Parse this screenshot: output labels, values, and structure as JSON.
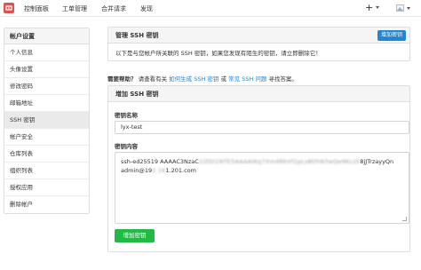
{
  "header": {
    "nav": [
      "控制面板",
      "工单管理",
      "合并请求",
      "发现"
    ],
    "plus": "+"
  },
  "sidebar": {
    "title": "帐户设置",
    "items": [
      "个人信息",
      "头像设置",
      "修改密码",
      "邮箱地址",
      "SSH 密钥",
      "帐户安全",
      "仓库列表",
      "组织列表",
      "授权应用",
      "删除帐户"
    ],
    "active_index": 4
  },
  "manage": {
    "title": "管理 SSH 密钥",
    "add_button": "增加密钥",
    "info": "以下是与您帐户所关联的 SSH 密钥，如果您发现有陌生的密钥，请立即删除它！"
  },
  "help": {
    "prefix": "需要帮助？",
    "text1": " 请查看有关 ",
    "link1": "如何生成 SSH 密钥",
    "text2": " 或 ",
    "link2": "常见 SSH 问题",
    "text3": " 寻找答案。"
  },
  "add_form": {
    "title": "增加 SSH 密钥",
    "name_label": "密钥名称",
    "name_value": "lyx-test",
    "content_label": "密钥内容",
    "content_start": "ssh-ed25519 AAAAC3NzaC",
    "content_blurred": "1lZDI1NTE5AAAAIKq7Xm4RbVf2pLs8DhN3wQe9Kcz5",
    "content_end": "8jJTrzayyQn",
    "content_line2_start": "admin@19",
    "content_line2_blurred": "2.16",
    "content_line2_end": "1.201.com",
    "submit": "增加密钥"
  },
  "colors": {
    "primary": "#2185d0",
    "success": "#21ba45",
    "logo": "#d9534f"
  }
}
